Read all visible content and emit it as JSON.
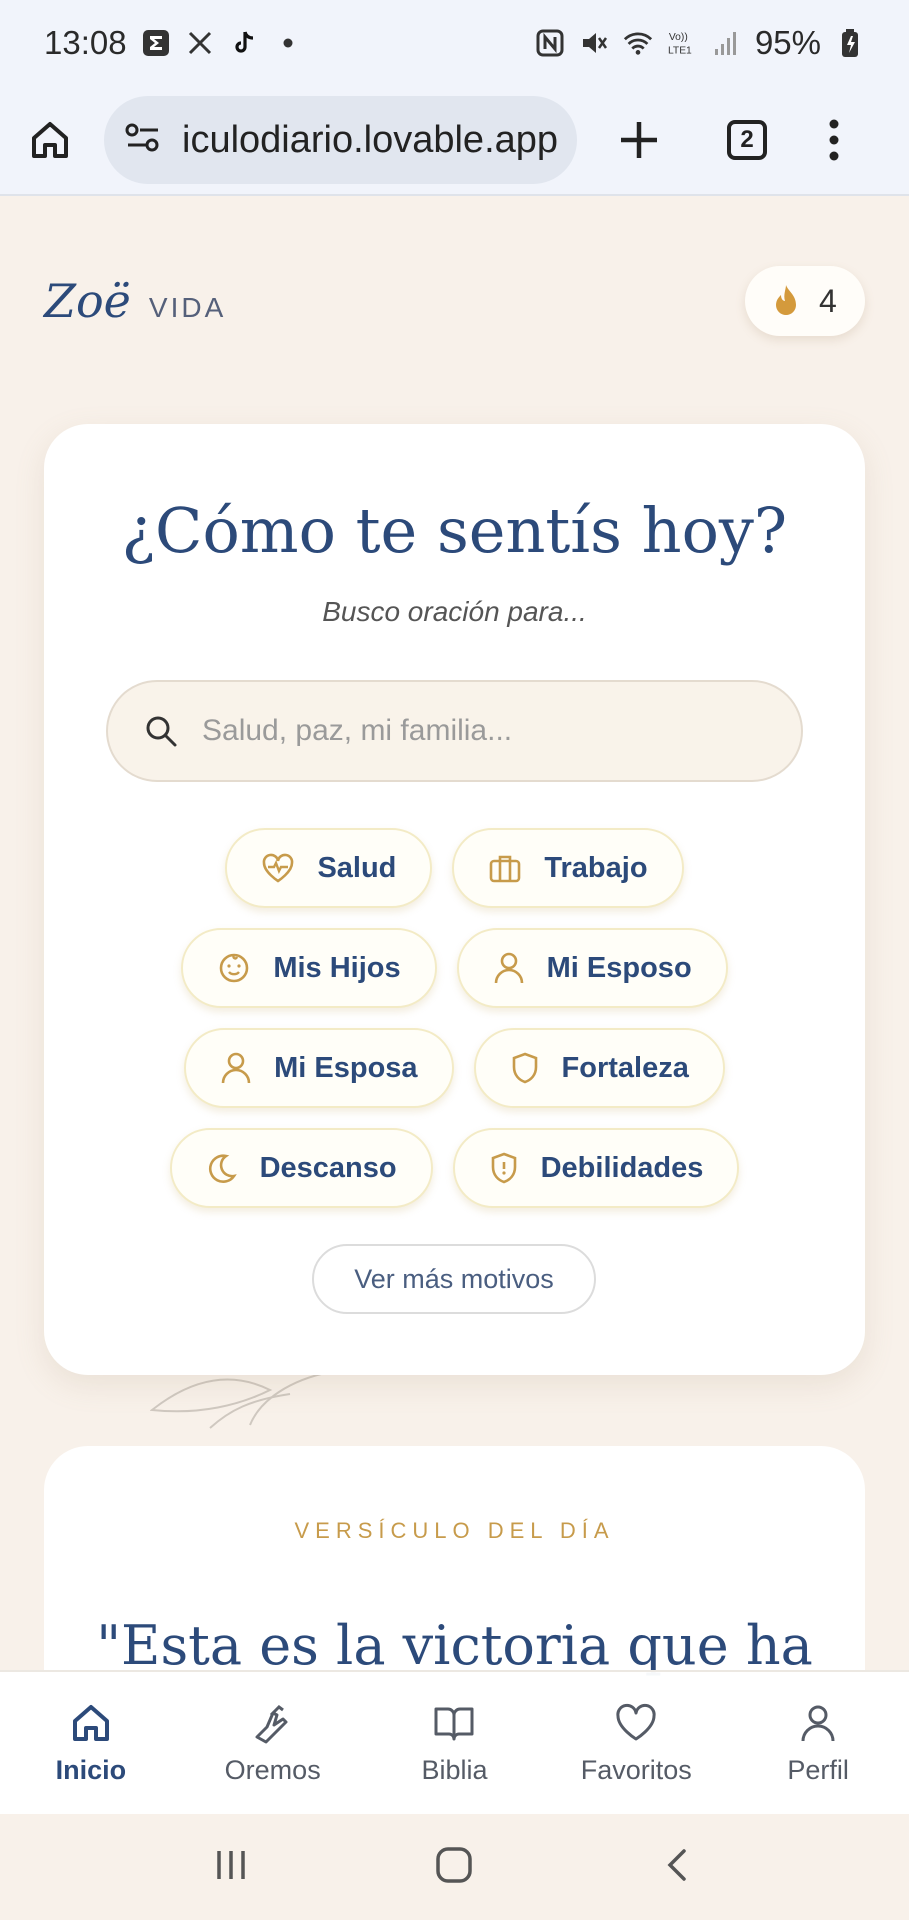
{
  "status_bar": {
    "time": "13:08",
    "battery": "95%",
    "notification_icons": [
      "sigma-icon",
      "tools-icon",
      "tiktok-icon",
      "dot-icon"
    ],
    "system_icons": [
      "nfc-icon",
      "mute-icon",
      "wifi-icon",
      "volte-icon",
      "signal-icon",
      "battery-icon"
    ]
  },
  "browser": {
    "url": "iculodiario.lovable.app",
    "tab_count": "2"
  },
  "header": {
    "brand_script": "Zoë",
    "brand_sub": "VIDA",
    "streak_count": "4"
  },
  "mood_card": {
    "title": "¿Cómo te sentís hoy?",
    "subtitle": "Busco oración para...",
    "search_placeholder": "Salud, paz, mi familia...",
    "chips": [
      {
        "label": "Salud",
        "icon": "heart-pulse-icon"
      },
      {
        "label": "Trabajo",
        "icon": "briefcase-icon"
      },
      {
        "label": "Mis Hijos",
        "icon": "baby-face-icon"
      },
      {
        "label": "Mi Esposo",
        "icon": "person-icon"
      },
      {
        "label": "Mi Esposa",
        "icon": "person-icon"
      },
      {
        "label": "Fortaleza",
        "icon": "shield-icon"
      },
      {
        "label": "Descanso",
        "icon": "moon-icon"
      },
      {
        "label": "Debilidades",
        "icon": "shield-alert-icon"
      }
    ],
    "more_label": "Ver más motivos"
  },
  "verse_card": {
    "label": "VERSÍCULO DEL DÍA",
    "text": "\"Esta es la victoria que ha"
  },
  "bottom_nav": [
    {
      "label": "Inicio",
      "icon": "home-icon",
      "active": true
    },
    {
      "label": "Oremos",
      "icon": "praying-hands-icon",
      "active": false
    },
    {
      "label": "Biblia",
      "icon": "book-icon",
      "active": false
    },
    {
      "label": "Favoritos",
      "icon": "heart-icon",
      "active": false
    },
    {
      "label": "Perfil",
      "icon": "user-icon",
      "active": false
    }
  ],
  "colors": {
    "navy": "#2c4a7a",
    "gold": "#c79b4b",
    "background": "#f8f1ea",
    "card": "#ffffff"
  }
}
